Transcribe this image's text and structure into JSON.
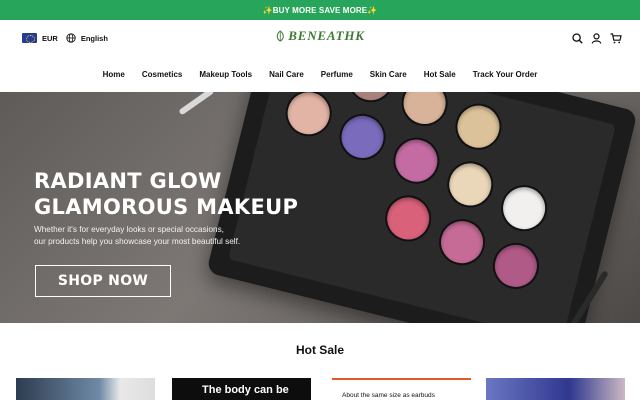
{
  "announcement": {
    "text": "✨BUY MORE SAVE MORE✨"
  },
  "header": {
    "currency": "EUR",
    "language": "English",
    "logo_text": "BENEATHK"
  },
  "nav": {
    "items": [
      "Home",
      "Cosmetics",
      "Makeup Tools",
      "Nail Care",
      "Perfume",
      "Skin Care",
      "Hot Sale",
      "Track Your Order"
    ]
  },
  "hero": {
    "headline_line1": "RADIANT GLOW",
    "headline_line2": "GLAMOROUS MAKEUP",
    "subtext_line1": "Whether it's for everyday looks or special occasions,",
    "subtext_line2": "our products help you showcase your most beautiful self.",
    "cta_label": "SHOP NOW"
  },
  "hot_sale": {
    "title": "Hot Sale",
    "cards": [
      {
        "caption": ""
      },
      {
        "caption": "The body can be"
      },
      {
        "caption": "About the same size as earbuds"
      },
      {
        "caption": ""
      }
    ]
  },
  "colors": {
    "announcement_bg": "#27a55a",
    "logo": "#3d7a34",
    "text": "#111111",
    "hero_overlay_text": "#ffffff"
  },
  "icons": [
    "flag-eu-icon",
    "globe-icon",
    "leaf-logo-icon",
    "search-icon",
    "account-icon",
    "cart-icon"
  ]
}
